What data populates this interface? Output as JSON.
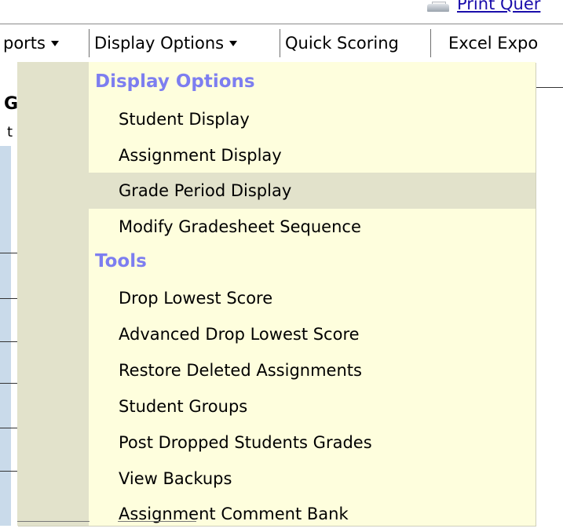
{
  "print_link": {
    "label": "Print Quer",
    "icon": "printer-icon"
  },
  "menubar": {
    "items": [
      {
        "label": "ports",
        "has_caret": true
      },
      {
        "label": "Display Options",
        "has_caret": true
      },
      {
        "label": "Quick Scoring",
        "has_caret": false
      },
      {
        "label": "Excel Expo",
        "has_caret": false
      }
    ]
  },
  "background": {
    "letter_top": "G",
    "letter_second": "t"
  },
  "dropdown": {
    "sections": [
      {
        "header": "Display Options",
        "items": [
          {
            "label": "Student Display",
            "hovered": false
          },
          {
            "label": "Assignment Display",
            "hovered": false
          },
          {
            "label": "Grade Period Display",
            "hovered": true
          },
          {
            "label": "Modify Gradesheet Sequence",
            "hovered": false
          }
        ]
      },
      {
        "header": "Tools",
        "items": [
          {
            "label": "Drop Lowest Score",
            "hovered": false
          },
          {
            "label": "Advanced Drop Lowest Score",
            "hovered": false
          },
          {
            "label": "Restore Deleted Assignments",
            "hovered": false
          },
          {
            "label": "Student Groups",
            "hovered": false
          },
          {
            "label": "Post Dropped Students Grades",
            "hovered": false
          },
          {
            "label": "View Backups",
            "hovered": false
          },
          {
            "label": "Assignment Comment Bank",
            "hovered": false
          }
        ]
      }
    ]
  },
  "colors": {
    "menu_bg": "#fefedd",
    "menu_strip": "#e2e2cb",
    "header_text": "#7d7ef0",
    "link": "#1a0dab"
  }
}
